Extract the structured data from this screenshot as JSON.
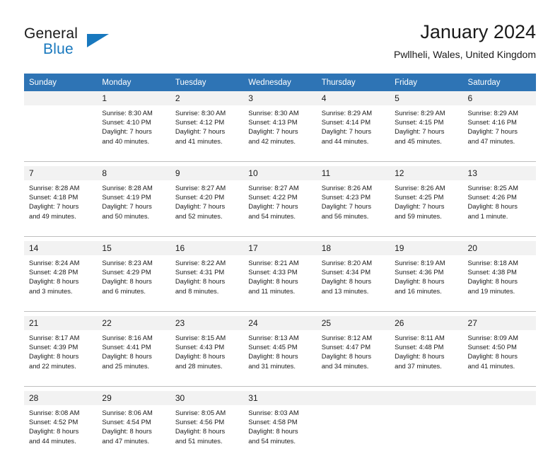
{
  "brand": {
    "name_top": "General",
    "name_bottom": "Blue",
    "accent_color": "#1878be"
  },
  "header": {
    "title": "January 2024",
    "subtitle": "Pwllheli, Wales, United Kingdom"
  },
  "theme": {
    "header_blue": "#2e74b5",
    "daynum_band": "#f2f2f2",
    "rule_gray": "#bfbfbf",
    "text": "#1a1a1a"
  },
  "weekdays": [
    "Sunday",
    "Monday",
    "Tuesday",
    "Wednesday",
    "Thursday",
    "Friday",
    "Saturday"
  ],
  "weeks": [
    [
      {
        "day": "",
        "sunrise": "",
        "sunset": "",
        "daylight1": "",
        "daylight2": ""
      },
      {
        "day": "1",
        "sunrise": "Sunrise: 8:30 AM",
        "sunset": "Sunset: 4:10 PM",
        "daylight1": "Daylight: 7 hours",
        "daylight2": "and 40 minutes."
      },
      {
        "day": "2",
        "sunrise": "Sunrise: 8:30 AM",
        "sunset": "Sunset: 4:12 PM",
        "daylight1": "Daylight: 7 hours",
        "daylight2": "and 41 minutes."
      },
      {
        "day": "3",
        "sunrise": "Sunrise: 8:30 AM",
        "sunset": "Sunset: 4:13 PM",
        "daylight1": "Daylight: 7 hours",
        "daylight2": "and 42 minutes."
      },
      {
        "day": "4",
        "sunrise": "Sunrise: 8:29 AM",
        "sunset": "Sunset: 4:14 PM",
        "daylight1": "Daylight: 7 hours",
        "daylight2": "and 44 minutes."
      },
      {
        "day": "5",
        "sunrise": "Sunrise: 8:29 AM",
        "sunset": "Sunset: 4:15 PM",
        "daylight1": "Daylight: 7 hours",
        "daylight2": "and 45 minutes."
      },
      {
        "day": "6",
        "sunrise": "Sunrise: 8:29 AM",
        "sunset": "Sunset: 4:16 PM",
        "daylight1": "Daylight: 7 hours",
        "daylight2": "and 47 minutes."
      }
    ],
    [
      {
        "day": "7",
        "sunrise": "Sunrise: 8:28 AM",
        "sunset": "Sunset: 4:18 PM",
        "daylight1": "Daylight: 7 hours",
        "daylight2": "and 49 minutes."
      },
      {
        "day": "8",
        "sunrise": "Sunrise: 8:28 AM",
        "sunset": "Sunset: 4:19 PM",
        "daylight1": "Daylight: 7 hours",
        "daylight2": "and 50 minutes."
      },
      {
        "day": "9",
        "sunrise": "Sunrise: 8:27 AM",
        "sunset": "Sunset: 4:20 PM",
        "daylight1": "Daylight: 7 hours",
        "daylight2": "and 52 minutes."
      },
      {
        "day": "10",
        "sunrise": "Sunrise: 8:27 AM",
        "sunset": "Sunset: 4:22 PM",
        "daylight1": "Daylight: 7 hours",
        "daylight2": "and 54 minutes."
      },
      {
        "day": "11",
        "sunrise": "Sunrise: 8:26 AM",
        "sunset": "Sunset: 4:23 PM",
        "daylight1": "Daylight: 7 hours",
        "daylight2": "and 56 minutes."
      },
      {
        "day": "12",
        "sunrise": "Sunrise: 8:26 AM",
        "sunset": "Sunset: 4:25 PM",
        "daylight1": "Daylight: 7 hours",
        "daylight2": "and 59 minutes."
      },
      {
        "day": "13",
        "sunrise": "Sunrise: 8:25 AM",
        "sunset": "Sunset: 4:26 PM",
        "daylight1": "Daylight: 8 hours",
        "daylight2": "and 1 minute."
      }
    ],
    [
      {
        "day": "14",
        "sunrise": "Sunrise: 8:24 AM",
        "sunset": "Sunset: 4:28 PM",
        "daylight1": "Daylight: 8 hours",
        "daylight2": "and 3 minutes."
      },
      {
        "day": "15",
        "sunrise": "Sunrise: 8:23 AM",
        "sunset": "Sunset: 4:29 PM",
        "daylight1": "Daylight: 8 hours",
        "daylight2": "and 6 minutes."
      },
      {
        "day": "16",
        "sunrise": "Sunrise: 8:22 AM",
        "sunset": "Sunset: 4:31 PM",
        "daylight1": "Daylight: 8 hours",
        "daylight2": "and 8 minutes."
      },
      {
        "day": "17",
        "sunrise": "Sunrise: 8:21 AM",
        "sunset": "Sunset: 4:33 PM",
        "daylight1": "Daylight: 8 hours",
        "daylight2": "and 11 minutes."
      },
      {
        "day": "18",
        "sunrise": "Sunrise: 8:20 AM",
        "sunset": "Sunset: 4:34 PM",
        "daylight1": "Daylight: 8 hours",
        "daylight2": "and 13 minutes."
      },
      {
        "day": "19",
        "sunrise": "Sunrise: 8:19 AM",
        "sunset": "Sunset: 4:36 PM",
        "daylight1": "Daylight: 8 hours",
        "daylight2": "and 16 minutes."
      },
      {
        "day": "20",
        "sunrise": "Sunrise: 8:18 AM",
        "sunset": "Sunset: 4:38 PM",
        "daylight1": "Daylight: 8 hours",
        "daylight2": "and 19 minutes."
      }
    ],
    [
      {
        "day": "21",
        "sunrise": "Sunrise: 8:17 AM",
        "sunset": "Sunset: 4:39 PM",
        "daylight1": "Daylight: 8 hours",
        "daylight2": "and 22 minutes."
      },
      {
        "day": "22",
        "sunrise": "Sunrise: 8:16 AM",
        "sunset": "Sunset: 4:41 PM",
        "daylight1": "Daylight: 8 hours",
        "daylight2": "and 25 minutes."
      },
      {
        "day": "23",
        "sunrise": "Sunrise: 8:15 AM",
        "sunset": "Sunset: 4:43 PM",
        "daylight1": "Daylight: 8 hours",
        "daylight2": "and 28 minutes."
      },
      {
        "day": "24",
        "sunrise": "Sunrise: 8:13 AM",
        "sunset": "Sunset: 4:45 PM",
        "daylight1": "Daylight: 8 hours",
        "daylight2": "and 31 minutes."
      },
      {
        "day": "25",
        "sunrise": "Sunrise: 8:12 AM",
        "sunset": "Sunset: 4:47 PM",
        "daylight1": "Daylight: 8 hours",
        "daylight2": "and 34 minutes."
      },
      {
        "day": "26",
        "sunrise": "Sunrise: 8:11 AM",
        "sunset": "Sunset: 4:48 PM",
        "daylight1": "Daylight: 8 hours",
        "daylight2": "and 37 minutes."
      },
      {
        "day": "27",
        "sunrise": "Sunrise: 8:09 AM",
        "sunset": "Sunset: 4:50 PM",
        "daylight1": "Daylight: 8 hours",
        "daylight2": "and 41 minutes."
      }
    ],
    [
      {
        "day": "28",
        "sunrise": "Sunrise: 8:08 AM",
        "sunset": "Sunset: 4:52 PM",
        "daylight1": "Daylight: 8 hours",
        "daylight2": "and 44 minutes."
      },
      {
        "day": "29",
        "sunrise": "Sunrise: 8:06 AM",
        "sunset": "Sunset: 4:54 PM",
        "daylight1": "Daylight: 8 hours",
        "daylight2": "and 47 minutes."
      },
      {
        "day": "30",
        "sunrise": "Sunrise: 8:05 AM",
        "sunset": "Sunset: 4:56 PM",
        "daylight1": "Daylight: 8 hours",
        "daylight2": "and 51 minutes."
      },
      {
        "day": "31",
        "sunrise": "Sunrise: 8:03 AM",
        "sunset": "Sunset: 4:58 PM",
        "daylight1": "Daylight: 8 hours",
        "daylight2": "and 54 minutes."
      },
      {
        "day": "",
        "sunrise": "",
        "sunset": "",
        "daylight1": "",
        "daylight2": ""
      },
      {
        "day": "",
        "sunrise": "",
        "sunset": "",
        "daylight1": "",
        "daylight2": ""
      },
      {
        "day": "",
        "sunrise": "",
        "sunset": "",
        "daylight1": "",
        "daylight2": ""
      }
    ]
  ]
}
